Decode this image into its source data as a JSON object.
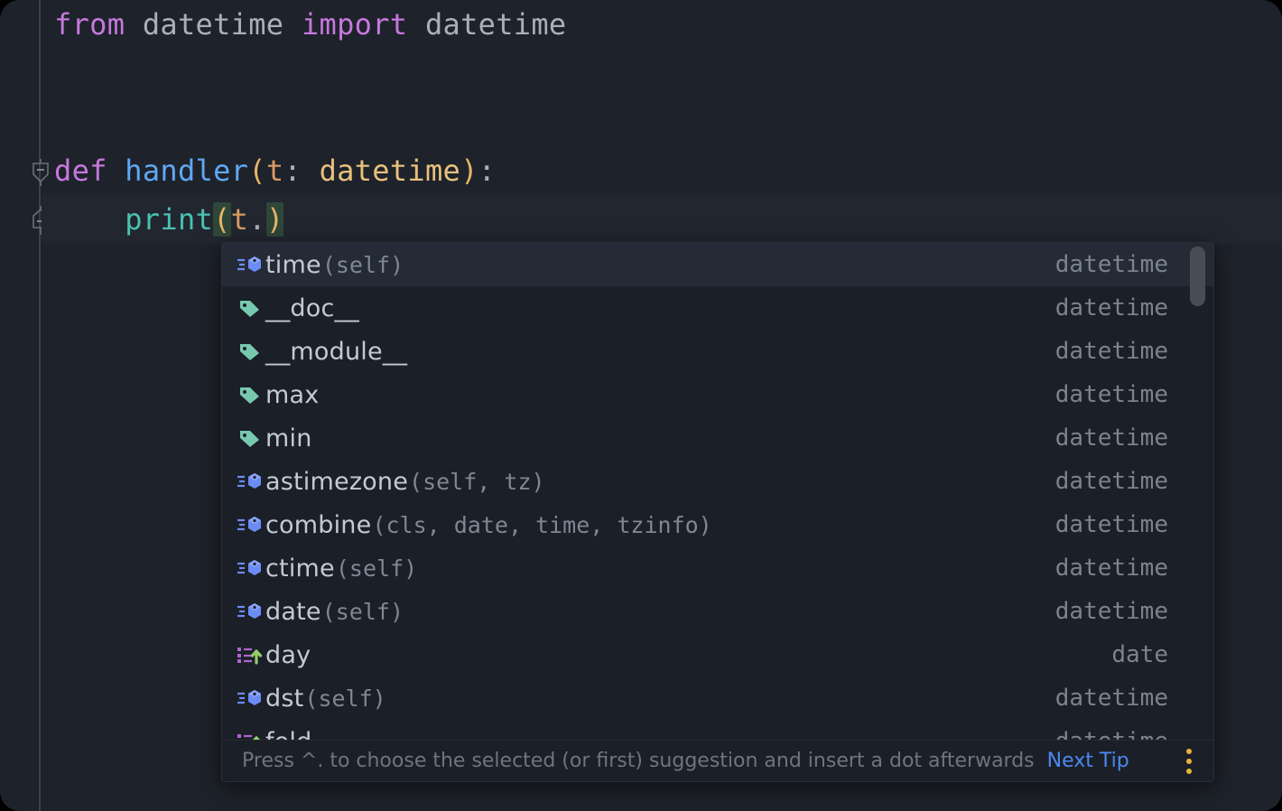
{
  "window": {
    "background_color": "#1E222A",
    "outer_color": "#000000"
  },
  "editor": {
    "gutter": {
      "fold_markers": [
        {
          "name": "fold-marker-def-handler",
          "shape": "collapse-arrow"
        },
        {
          "name": "fold-marker-print-body",
          "shape": "collapse-end"
        }
      ]
    },
    "lines": [
      {
        "index": 1,
        "tokens": [
          {
            "text": "from",
            "kind": "keyword"
          },
          {
            "text": " ",
            "kind": "plain"
          },
          {
            "text": "datetime",
            "kind": "plain"
          },
          {
            "text": " ",
            "kind": "plain"
          },
          {
            "text": "import",
            "kind": "keyword"
          },
          {
            "text": " ",
            "kind": "plain"
          },
          {
            "text": "datetime",
            "kind": "plain"
          }
        ]
      },
      {
        "index": 4,
        "tokens": [
          {
            "text": "def",
            "kind": "keyword"
          },
          {
            "text": " ",
            "kind": "plain"
          },
          {
            "text": "handler",
            "kind": "function-def"
          },
          {
            "text": "(",
            "kind": "paren"
          },
          {
            "text": "t",
            "kind": "param"
          },
          {
            "text": ":",
            "kind": "punct"
          },
          {
            "text": " ",
            "kind": "plain"
          },
          {
            "text": "datetime",
            "kind": "type"
          },
          {
            "text": ")",
            "kind": "paren"
          },
          {
            "text": ":",
            "kind": "punct"
          }
        ]
      },
      {
        "index": 5,
        "tokens": [
          {
            "text": "    ",
            "kind": "plain"
          },
          {
            "text": "print",
            "kind": "function-call"
          },
          {
            "text": "(",
            "kind": "paren-match"
          },
          {
            "text": "t",
            "kind": "param"
          },
          {
            "text": ".",
            "kind": "punct"
          },
          {
            "text": ")",
            "kind": "paren-match"
          }
        ]
      }
    ],
    "caret_line": 5,
    "code_text": {
      "line1": "from datetime import datetime",
      "line4": "def handler(t: datetime):",
      "line5": "    print(t.)"
    }
  },
  "completion_popup": {
    "selected_index": 0,
    "items": [
      {
        "icon": "method-icon",
        "name": "time",
        "params": "(self)",
        "source": "datetime",
        "selected": true
      },
      {
        "icon": "field-icon",
        "name": "__doc__",
        "params": "",
        "source": "datetime",
        "selected": false
      },
      {
        "icon": "field-icon",
        "name": "__module__",
        "params": "",
        "source": "datetime",
        "selected": false
      },
      {
        "icon": "field-icon",
        "name": "max",
        "params": "",
        "source": "datetime",
        "selected": false
      },
      {
        "icon": "field-icon",
        "name": "min",
        "params": "",
        "source": "datetime",
        "selected": false
      },
      {
        "icon": "method-icon",
        "name": "astimezone",
        "params": "(self, tz)",
        "source": "datetime",
        "selected": false
      },
      {
        "icon": "method-icon",
        "name": "combine",
        "params": "(cls, date, time, tzinfo)",
        "source": "datetime",
        "selected": false
      },
      {
        "icon": "method-icon",
        "name": "ctime",
        "params": "(self)",
        "source": "datetime",
        "selected": false
      },
      {
        "icon": "method-icon",
        "name": "date",
        "params": "(self)",
        "source": "datetime",
        "selected": false
      },
      {
        "icon": "property-icon",
        "name": "day",
        "params": "",
        "source": "date",
        "selected": false
      },
      {
        "icon": "method-icon",
        "name": "dst",
        "params": "(self)",
        "source": "datetime",
        "selected": false
      },
      {
        "icon": "property-icon",
        "name": "fold",
        "params": "",
        "source": "datetime",
        "selected": false
      }
    ],
    "scrollbar": {
      "thumb_top_pct": 0,
      "thumb_height_pct": 12
    },
    "status": {
      "tip_text": "Press ^. to choose the selected (or first) suggestion and insert a dot afterwards",
      "next_tip_label": "Next Tip",
      "menu_icon": "kebab-menu-icon"
    }
  },
  "colors": {
    "keyword": "#C678DD",
    "function_def": "#5FA8F5",
    "function_call": "#49C1B1",
    "param": "#D99B63",
    "type": "#E8C07D",
    "paren": "#E5B567",
    "plain": "#A9B0BC",
    "popup_bg": "#1B1F27",
    "popup_selected": "#252B36",
    "link": "#4C88F0",
    "menu_dot": "#E8B23A",
    "method_icon": "#6C8CF5",
    "field_icon": "#77C9AE",
    "property_icon_list": "#B265D4",
    "property_icon_arrow": "#93CC6E"
  }
}
